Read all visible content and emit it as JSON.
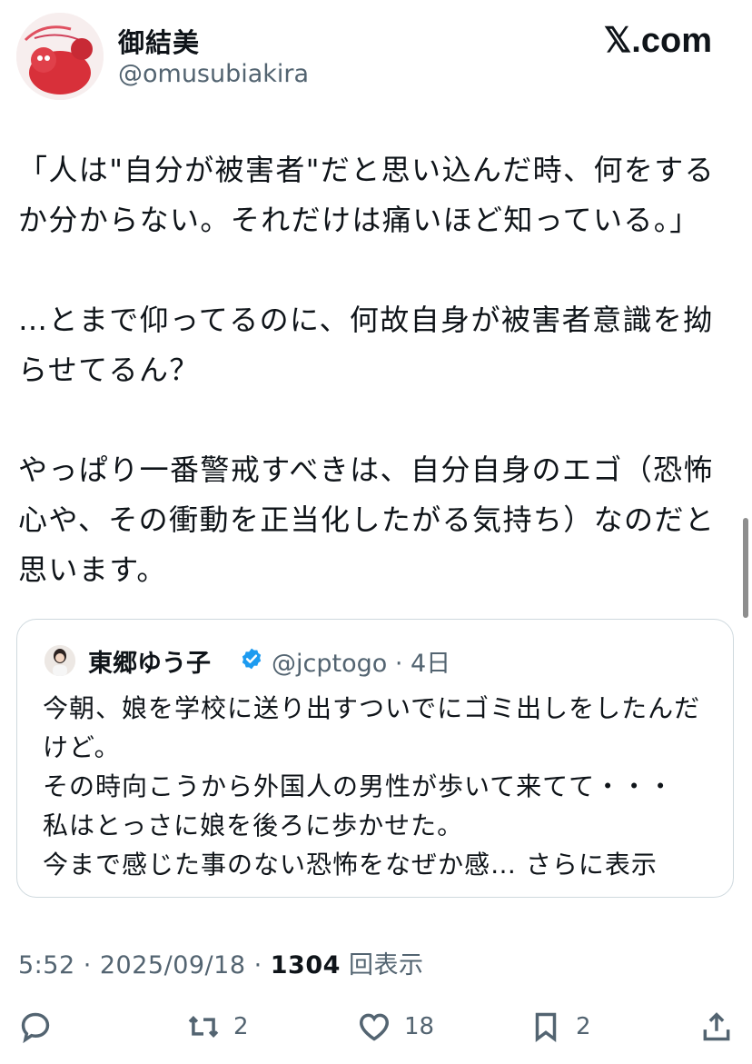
{
  "header": {
    "author_name": "御結美",
    "author_handle": "@omusubiakira",
    "site_label": "𝕏.com"
  },
  "post": {
    "paragraphs": [
      "「人は\"自分が被害者\"だと思い込んだ時、何をするか分からない。それだけは痛いほど知っている。」",
      "…とまで仰ってるのに、何故自身が被害者意識を拗らせてるん？",
      "やっぱり一番警戒すべきは、自分自身のエゴ（恐怖心や、その衝動を正当化したがる気持ち）なのだと思います。"
    ]
  },
  "quote": {
    "name": "東郷ゆう子",
    "handle_time": "@jcptogo · 4日",
    "text": "今朝、娘を学校に送り出すついでにゴミ出しをしたんだけど。\nその時向こうから外国人の男性が歩いて来てて・・・\n私はとっさに娘を後ろに歩かせた。\n今まで感じた事のない恐怖をなぜか感…",
    "show_more": " さらに表示"
  },
  "meta": {
    "time_date": "5:52 · 2025/09/18 · ",
    "views_count": "1304",
    "views_label": " 回表示"
  },
  "actions": {
    "reply_icon": "reply-icon",
    "retweet_count": "2",
    "like_count": "18",
    "bookmark_count": "2"
  },
  "colors": {
    "text": "#0f1419",
    "secondary": "#536471",
    "border": "#cfd9de",
    "verified": "#1d9bf0"
  }
}
